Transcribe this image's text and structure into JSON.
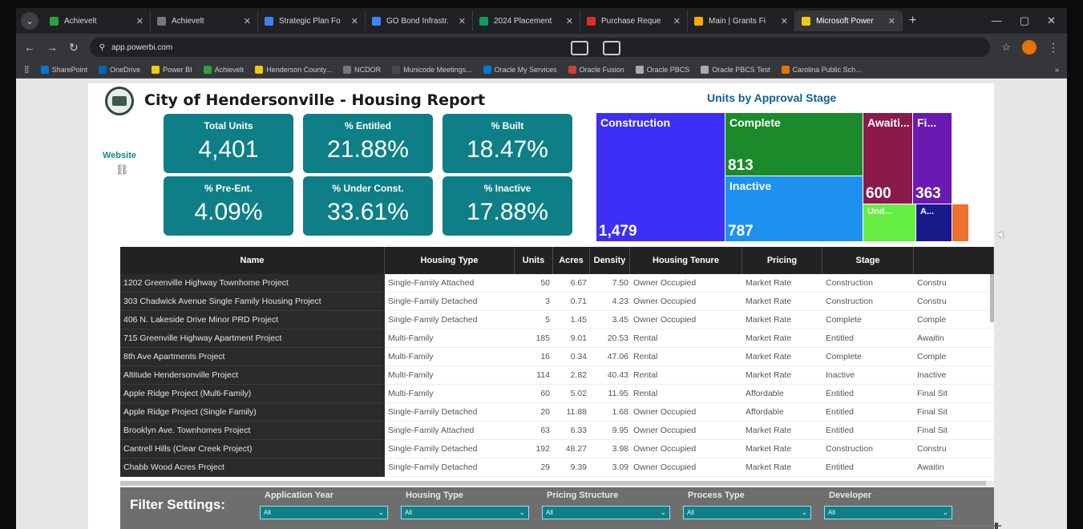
{
  "browser": {
    "tabs": [
      {
        "title": "Achievelt",
        "color": "#2ea043"
      },
      {
        "title": "Achievelt",
        "color": "#777777"
      },
      {
        "title": "Strategic Plan Fo",
        "color": "#3b82f6"
      },
      {
        "title": "GO Bond Infrastr.",
        "color": "#4285f4"
      },
      {
        "title": "2024 Placement",
        "color": "#0f9d58"
      },
      {
        "title": "Purchase Reque",
        "color": "#d93025"
      },
      {
        "title": "Main | Grants Fi",
        "color": "#f9ab00"
      },
      {
        "title": "Microsoft Power",
        "color": "#f2c811"
      }
    ],
    "active_tab": 7,
    "url": "app.powerbi.com",
    "bookmarks": [
      "SharePoint",
      "OneDrive",
      "Power BI",
      "Achievelt",
      "Henderson County...",
      "NCDOR",
      "Municode Meetings...",
      "Oracle My Services",
      "Oracle Fusion",
      "Oracle PBCS",
      "Oracle PBCS Test",
      "Carolina Public Sch..."
    ]
  },
  "report": {
    "title": "City of Hendersonville - Housing Report",
    "website_label": "Website",
    "kpis": [
      {
        "label": "Total Units",
        "value": "4,401"
      },
      {
        "label": "% Entitled",
        "value": "21.88%"
      },
      {
        "label": "% Built",
        "value": "18.47%"
      },
      {
        "label": "% Pre-Ent.",
        "value": "4.09%"
      },
      {
        "label": "% Under Const.",
        "value": "33.61%"
      },
      {
        "label": "% Inactive",
        "value": "17.88%"
      }
    ],
    "treemap": {
      "title": "Units by Approval Stage",
      "tiles": [
        {
          "label": "Construction",
          "value": "1,479",
          "color": "#3d2ff5"
        },
        {
          "label": "Complete",
          "value": "813",
          "color": "#1a8a2a"
        },
        {
          "label": "Inactive",
          "value": "787",
          "color": "#1e90f0"
        },
        {
          "label": "Awaiti...",
          "value": "600",
          "color": "#8a1a4a"
        },
        {
          "label": "Fi...",
          "value": "363",
          "color": "#6a1ab0"
        },
        {
          "label": "Und...",
          "value": "",
          "color": "#66ee44"
        },
        {
          "label": "A...",
          "value": "",
          "color": "#1a1a8a"
        },
        {
          "label": "",
          "value": "",
          "color": "#f07030"
        }
      ]
    },
    "table": {
      "columns": [
        "Name",
        "Housing Type",
        "Units",
        "Acres",
        "Density",
        "Housing Tenure",
        "Pricing",
        "Stage",
        ""
      ],
      "rows": [
        [
          "1202 Greenville Highway Townhome Project",
          "Single-Family Attached",
          "50",
          "6.67",
          "7.50",
          "Owner Occupied",
          "Market Rate",
          "Construction",
          "Constru"
        ],
        [
          "303 Chadwick Avenue Single Family Housing Project",
          "Single-Family Detached",
          "3",
          "0.71",
          "4.23",
          "Owner Occupied",
          "Market Rate",
          "Construction",
          "Constru"
        ],
        [
          "406 N. Lakeside Drive Minor PRD Project",
          "Single-Family Detached",
          "5",
          "1.45",
          "3.45",
          "Owner Occupied",
          "Market Rate",
          "Complete",
          "Comple"
        ],
        [
          "715 Greenville Highway Apartment Project",
          "Multi-Family",
          "185",
          "9.01",
          "20.53",
          "Rental",
          "Market Rate",
          "Entitled",
          "Awaitin"
        ],
        [
          "8th Ave Apartments Project",
          "Multi-Family",
          "16",
          "0.34",
          "47.06",
          "Rental",
          "Market Rate",
          "Complete",
          "Comple"
        ],
        [
          "Altitude Hendersonville Project",
          "Multi-Family",
          "114",
          "2.82",
          "40.43",
          "Rental",
          "Market Rate",
          "Inactive",
          "Inactive"
        ],
        [
          "Apple Ridge Project (Multi-Family)",
          "Multi-Family",
          "60",
          "5.02",
          "11.95",
          "Rental",
          "Affordable",
          "Entitled",
          "Final Sit"
        ],
        [
          "Apple Ridge Project (Single Family)",
          "Single-Family Detached",
          "20",
          "11.88",
          "1.68",
          "Owner Occupied",
          "Affordable",
          "Entitled",
          "Final Sit"
        ],
        [
          "Brooklyn Ave. Townhomes Project",
          "Single-Family Attached",
          "63",
          "6.33",
          "9.95",
          "Owner Occupied",
          "Market Rate",
          "Entitled",
          "Final Sit"
        ],
        [
          "Cantrell Hills (Clear Creek Project)",
          "Single-Family Detached",
          "192",
          "48.27",
          "3.98",
          "Owner Occupied",
          "Market Rate",
          "Construction",
          "Constru"
        ],
        [
          "Chabb Wood Acres Project",
          "Single-Family Detached",
          "29",
          "9.39",
          "3.09",
          "Owner Occupied",
          "Market Rate",
          "Entitled",
          "Awaitin"
        ]
      ]
    },
    "filters": {
      "label": "Filter Settings:",
      "items": [
        {
          "label": "Application Year",
          "value": "All"
        },
        {
          "label": "Housing Type",
          "value": "All"
        },
        {
          "label": "Pricing Structure",
          "value": "All"
        },
        {
          "label": "Process Type",
          "value": "All"
        },
        {
          "label": "Developer",
          "value": "All"
        }
      ]
    }
  }
}
